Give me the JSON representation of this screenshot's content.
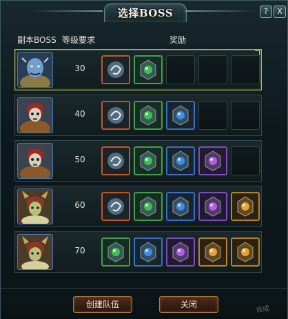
{
  "window": {
    "title": "选择BOSS",
    "help_label": "?",
    "close_label": "X"
  },
  "headers": {
    "boss": "副本BOSS",
    "level": "等级要求",
    "reward": "奖励"
  },
  "rows": [
    {
      "level": "30",
      "boss": "blue-ogre",
      "selected": true,
      "rewards": [
        "swirl-orb-orange",
        "green-gem",
        "empty",
        "empty",
        "empty"
      ]
    },
    {
      "level": "40",
      "boss": "skull-warrior",
      "rewards": [
        "swirl-orb-orange",
        "green-gem",
        "blue-gem",
        "empty",
        "empty"
      ]
    },
    {
      "level": "50",
      "boss": "skull-warrior",
      "rewards": [
        "swirl-orb-orange",
        "green-gem",
        "blue-gem",
        "purple-gem",
        "empty"
      ]
    },
    {
      "level": "60",
      "boss": "horned-shaman",
      "rewards": [
        "swirl-orb-orange",
        "green-gem",
        "blue-gem",
        "purple-gem",
        "gold-gem"
      ]
    },
    {
      "level": "70",
      "boss": "horned-shaman",
      "rewards": [
        "green-gem",
        "blue-gem",
        "purple-gem",
        "gold-gem",
        "gold-gem"
      ]
    }
  ],
  "buttons": {
    "create_team": "创建队伍",
    "close": "关闭"
  },
  "watermark": "合成",
  "colors": {
    "selected_border": "#a7c45a",
    "button_border": "#b07b3d",
    "gem_green": "#3fbf55",
    "gem_blue": "#3d8cf0",
    "gem_purple": "#b05ee8",
    "gem_gold": "#f0a030",
    "orb_frame": "#c2542a"
  }
}
